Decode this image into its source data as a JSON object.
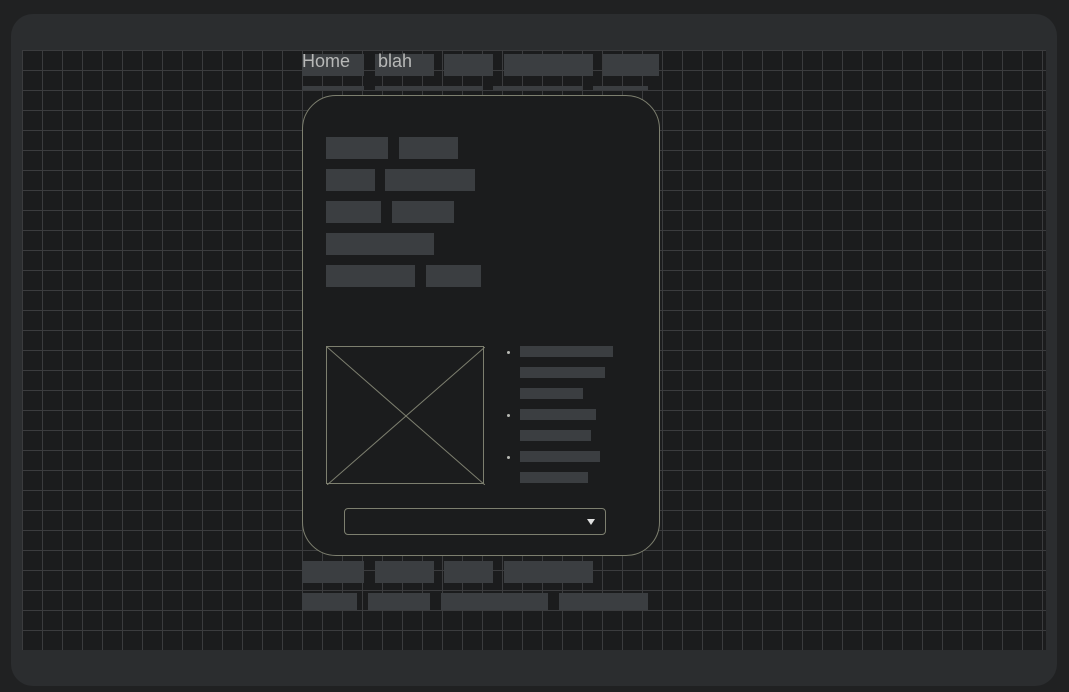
{
  "nav": {
    "items": [
      {
        "label": "Home"
      },
      {
        "label": "blah"
      }
    ]
  },
  "form": {
    "select": {
      "value": ""
    }
  },
  "icons": {
    "image_placeholder": "image-placeholder-icon",
    "dropdown": "caret-down-icon"
  },
  "colors": {
    "background": "#202122",
    "frame": "#2b2d2f",
    "canvas": "#1b1c1d",
    "grid": "#3b3c3e",
    "placeholder_block": "#3b3e41",
    "outline": "#7d7f6f",
    "text": "#b7b8b7"
  }
}
